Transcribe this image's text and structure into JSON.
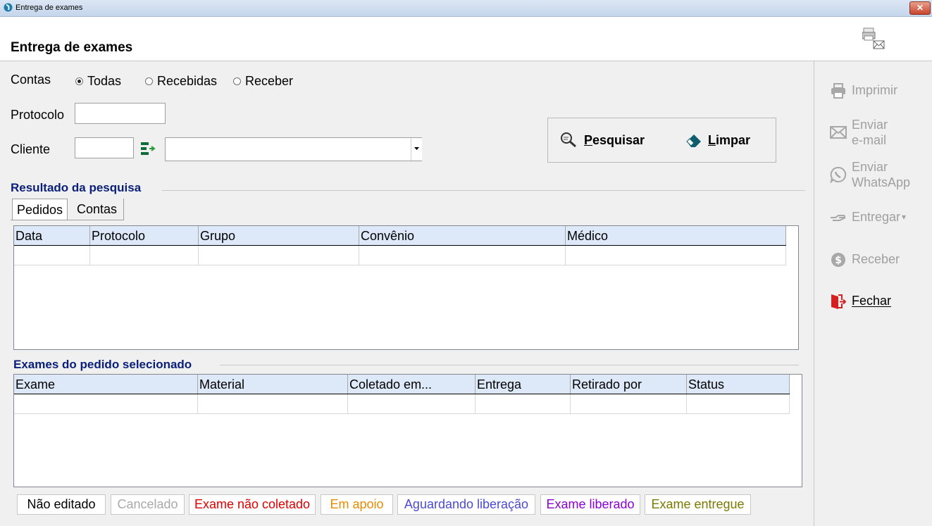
{
  "window": {
    "title": "Entrega de exames",
    "close_glyph": "✕"
  },
  "header": {
    "title": "Entrega de exames",
    "icon": "print-mail-icon"
  },
  "form": {
    "contas_label": "Contas",
    "radios": [
      {
        "label": "Todas",
        "checked": true
      },
      {
        "label": "Recebidas",
        "checked": false
      },
      {
        "label": "Receber",
        "checked": false
      }
    ],
    "protocolo_label": "Protocolo",
    "protocolo_value": "",
    "cliente_label": "Cliente",
    "cliente_code_value": "",
    "cliente_select_value": ""
  },
  "actions": {
    "pesquisar_first": "P",
    "pesquisar_rest": "esquisar",
    "limpar_first": "L",
    "limpar_rest": "impar"
  },
  "results": {
    "title": "Resultado da pesquisa",
    "tabs": [
      "Pedidos",
      "Contas"
    ],
    "active_tab": 0,
    "columns": [
      "Data",
      "Protocolo",
      "Grupo",
      "Convênio",
      "Médico"
    ]
  },
  "exams": {
    "title": "Exames do pedido selecionado",
    "columns": [
      "Exame",
      "Material",
      "Coletado em...",
      "Entrega",
      "Retirado por",
      "Status"
    ]
  },
  "legend": [
    {
      "label": "Não editado",
      "color": "#000000"
    },
    {
      "label": "Cancelado",
      "color": "#a9a9a9"
    },
    {
      "label": "Exame não coletado",
      "color": "#e00000"
    },
    {
      "label": "Em apoio",
      "color": "#e88a00"
    },
    {
      "label": "Aguardando liberação",
      "color": "#4a4ad8"
    },
    {
      "label": "Exame liberado",
      "color": "#8a00d8"
    },
    {
      "label": "Exame entregue",
      "color": "#7a7a00"
    }
  ],
  "side": {
    "imprimir": "Imprimir",
    "enviar_email": "Enviar\ne-mail",
    "enviar_whatsapp": "Enviar\nWhatsApp",
    "entregar": "Entregar",
    "entregar_caret": "▾",
    "receber": "Receber",
    "fechar_first": "F",
    "fechar_rest": "echar"
  }
}
